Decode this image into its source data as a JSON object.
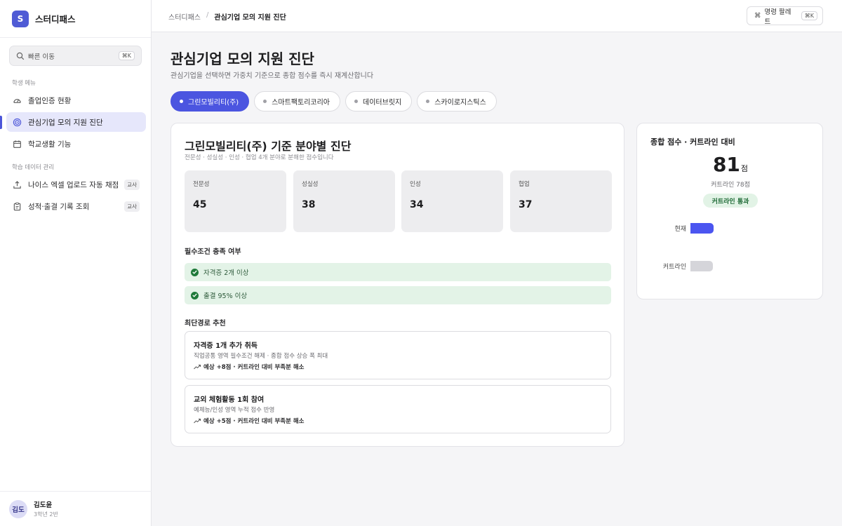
{
  "app": {
    "name": "스터디패스",
    "logo_letter": "S"
  },
  "search": {
    "label": "빠른 이동",
    "shortcut": "⌘K"
  },
  "sidebar": {
    "student_section": "학생 메뉴",
    "student_items": [
      {
        "label": "졸업인증 현황",
        "icon": "dashboard-gauge-icon"
      },
      {
        "label": "관심기업 모의 지원 진단",
        "icon": "target-icon",
        "active": true
      },
      {
        "label": "학교생활 기능",
        "icon": "calendar-icon"
      }
    ],
    "data_section": "학습 데이터 관리",
    "data_items": [
      {
        "label": "나이스 엑셀 업로드 자동 채점",
        "icon": "upload-icon",
        "tag": "교사"
      },
      {
        "label": "성적·출결 기록 조회",
        "icon": "clipboard-icon",
        "tag": "교사"
      }
    ]
  },
  "user": {
    "avatar": "김도",
    "name": "김도윤",
    "detail": "3학년 2반"
  },
  "topbar": {
    "breadcrumb_root": "스터디패스",
    "breadcrumb_sep": "/",
    "breadcrumb_current": "관심기업 모의 지원 진단",
    "command_label": "명령 팔레트",
    "command_icon": "⌘",
    "command_shortcut": "⌘K"
  },
  "page": {
    "title": "관심기업 모의 지원 진단",
    "subtitle": "관심기업을 선택하면 가중치 기준으로 종합 점수를 즉시 재계산합니다"
  },
  "companies": [
    {
      "label": "그린모빌리티(주)",
      "active": true
    },
    {
      "label": "스마트팩토리코리아",
      "active": false
    },
    {
      "label": "데이터브릿지",
      "active": false
    },
    {
      "label": "스카이로지스틱스",
      "active": false
    }
  ],
  "diagnosis": {
    "title": "그린모빌리티(주) 기준 분야별 진단",
    "subtitle": "전문성 · 성실성 · 인성 · 협업 4개 분야로 분해한 점수입니다",
    "metrics": [
      {
        "label": "전문성",
        "value": "45"
      },
      {
        "label": "성실성",
        "value": "38"
      },
      {
        "label": "인성",
        "value": "34"
      },
      {
        "label": "협업",
        "value": "37"
      }
    ],
    "requirements_title": "필수조건 충족 여부",
    "requirements": [
      {
        "label": "자격증 2개 이상",
        "met": true
      },
      {
        "label": "출결 95% 이상",
        "met": true
      }
    ],
    "recommendations_title": "최단경로 추천",
    "recommendations": [
      {
        "title": "자격증 1개 추가 취득",
        "desc": "직업공통 영역 필수조건 해제 · 종합 점수 상승 폭 최대",
        "gain": "예상 +8점 · 커트라인 대비 부족분 해소"
      },
      {
        "title": "교외 체험활동 1회 참여",
        "desc": "예체능/인성 영역 누적 점수 반영",
        "gain": "예상 +5점 · 커트라인 대비 부족분 해소"
      }
    ]
  },
  "summary": {
    "title": "종합 점수 · 커트라인 대비",
    "score": "81",
    "unit": "점",
    "cutline_text": "커트라인 78점",
    "badge": "커트라인 통과",
    "chart_data": {
      "type": "bar",
      "categories": [
        "현재",
        "커트라인"
      ],
      "values": [
        81,
        78
      ],
      "colors": [
        "#4b55f0",
        "#d5d5da"
      ]
    }
  },
  "colors": {
    "accent": "#4b55e0",
    "success": "#1f7a3a",
    "success_bg": "#e3f3e7"
  }
}
